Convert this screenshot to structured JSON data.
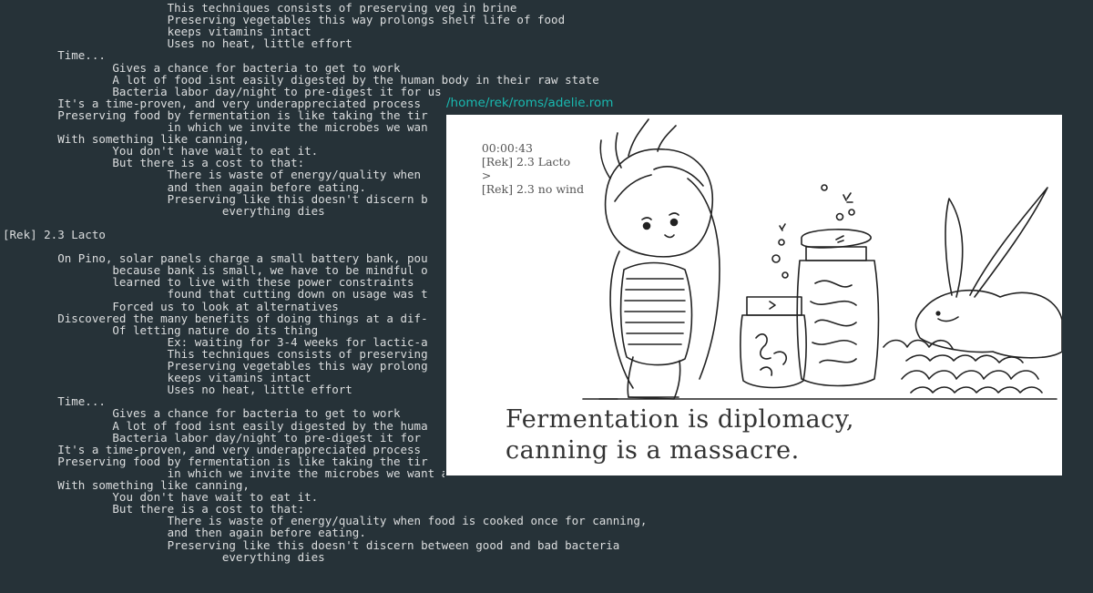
{
  "terminal": {
    "lines": [
      "                        This techniques consists of preserving veg in brine",
      "                        Preserving vegetables this way prolongs shelf life of food",
      "                        keeps vitamins intact",
      "                        Uses no heat, little effort",
      "        Time...",
      "                Gives a chance for bacteria to get to work",
      "                A lot of food isnt easily digested by the human body in their raw state",
      "                Bacteria labor day/night to pre-digest it for us",
      "        It's a time-proven, and very underappreciated process",
      "        Preserving food by fermentation is like taking the tir",
      "                        in which we invite the microbes we wan",
      "        With something like canning,",
      "                You don't have wait to eat it.",
      "                But there is a cost to that:",
      "                        There is waste of energy/quality when",
      "                        and then again before eating.",
      "                        Preserving like this doesn't discern b",
      "                                everything dies",
      "",
      "[Rek] 2.3 Lacto",
      "",
      "        On Pino, solar panels charge a small battery bank, pou",
      "                because bank is small, we have to be mindful o",
      "                learned to live with these power constraints",
      "                        found that cutting down on usage was t",
      "                Forced us to look at alternatives",
      "        Discovered the many benefits of doing things at a dif-",
      "                Of letting nature do its thing",
      "                        Ex: waiting for 3-4 weeks for lactic-a",
      "                        This techniques consists of preserving",
      "                        Preserving vegetables this way prolong",
      "                        keeps vitamins intact",
      "                        Uses no heat, little effort",
      "        Time...",
      "                Gives a chance for bacteria to get to work",
      "                A lot of food isnt easily digested by the huma",
      "                Bacteria labor day/night to pre-digest it for",
      "        It's a time-proven, and very underappreciated process",
      "        Preserving food by fermentation is like taking the tir",
      "                        in which we invite the microbes we want and don't let in the ones we don't.",
      "        With something like canning,",
      "                You don't have wait to eat it.",
      "                But there is a cost to that:",
      "                        There is waste of energy/quality when food is cooked once for canning,",
      "                        and then again before eating.",
      "                        Preserving like this doesn't discern between good and bad bacteria",
      "                                everything dies"
    ]
  },
  "viewer": {
    "title": "/home/rek/roms/adelie.rom",
    "timer": "00:00:43",
    "current_section": "[Rek] 2.3 Lacto",
    "separator": ">",
    "next_section": "[Rek] 2.3 no wind",
    "caption_line1": "Fermentation is diplomacy,",
    "caption_line2": "canning is a massacre."
  },
  "colors": {
    "background": "#263238",
    "terminal_text": "#dcdedf",
    "title_accent": "#19b9b0",
    "frame_bg": "#ffffff"
  }
}
